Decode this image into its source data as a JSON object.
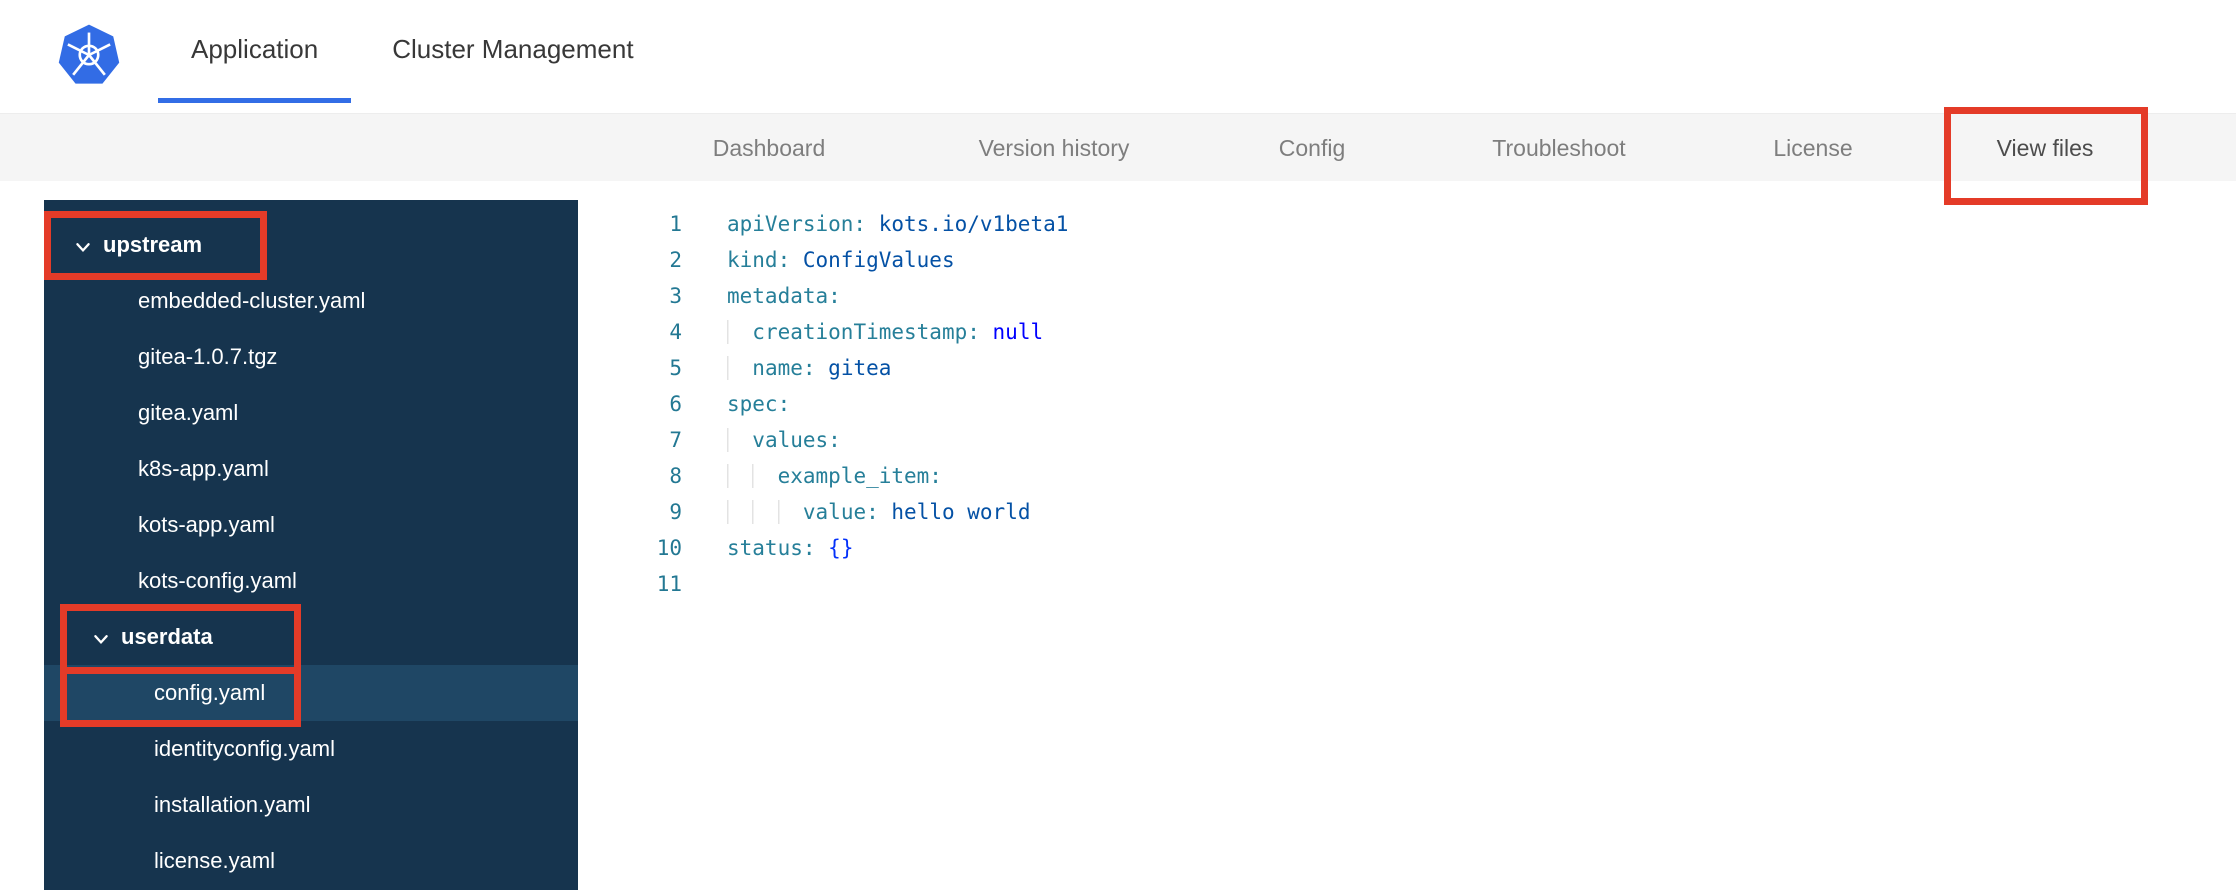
{
  "header": {
    "logo": "kubernetes-logo",
    "tabs": [
      {
        "label": "Application",
        "active": true
      },
      {
        "label": "Cluster Management",
        "active": false
      }
    ]
  },
  "subnav": {
    "tabs": [
      {
        "label": "Dashboard",
        "active": false
      },
      {
        "label": "Version history",
        "active": false
      },
      {
        "label": "Config",
        "active": false
      },
      {
        "label": "Troubleshoot",
        "active": false
      },
      {
        "label": "License",
        "active": false
      },
      {
        "label": "View files",
        "active": true,
        "annotated": true
      }
    ]
  },
  "file_tree": {
    "items": [
      {
        "type": "folder",
        "label": "upstream",
        "indent": 0,
        "expanded": true,
        "annotated": true
      },
      {
        "type": "file",
        "label": "embedded-cluster.yaml",
        "indent": 1
      },
      {
        "type": "file",
        "label": "gitea-1.0.7.tgz",
        "indent": 1
      },
      {
        "type": "file",
        "label": "gitea.yaml",
        "indent": 1
      },
      {
        "type": "file",
        "label": "k8s-app.yaml",
        "indent": 1
      },
      {
        "type": "file",
        "label": "kots-app.yaml",
        "indent": 1
      },
      {
        "type": "file",
        "label": "kots-config.yaml",
        "indent": 1
      },
      {
        "type": "folder",
        "label": "userdata",
        "indent": 1,
        "expanded": true,
        "annotated": true
      },
      {
        "type": "file",
        "label": "config.yaml",
        "indent": 2,
        "selected": true,
        "annotated": true
      },
      {
        "type": "file",
        "label": "identityconfig.yaml",
        "indent": 2
      },
      {
        "type": "file",
        "label": "installation.yaml",
        "indent": 2
      },
      {
        "type": "file",
        "label": "license.yaml",
        "indent": 2
      }
    ]
  },
  "editor": {
    "language": "yaml",
    "lines": [
      {
        "tokens": [
          {
            "c": "k",
            "t": "apiVersion:"
          },
          {
            "c": "sp",
            "t": " "
          },
          {
            "c": "v",
            "t": "kots.io/v1beta1"
          }
        ]
      },
      {
        "tokens": [
          {
            "c": "k",
            "t": "kind:"
          },
          {
            "c": "sp",
            "t": " "
          },
          {
            "c": "v",
            "t": "ConfigValues"
          }
        ]
      },
      {
        "tokens": [
          {
            "c": "k",
            "t": "metadata:"
          }
        ]
      },
      {
        "tokens": [
          {
            "c": "ind",
            "t": "  "
          },
          {
            "c": "k",
            "t": "creationTimestamp:"
          },
          {
            "c": "sp",
            "t": " "
          },
          {
            "c": "kw",
            "t": "null"
          }
        ]
      },
      {
        "tokens": [
          {
            "c": "ind",
            "t": "  "
          },
          {
            "c": "k",
            "t": "name:"
          },
          {
            "c": "sp",
            "t": " "
          },
          {
            "c": "v",
            "t": "gitea"
          }
        ]
      },
      {
        "tokens": [
          {
            "c": "k",
            "t": "spec:"
          }
        ]
      },
      {
        "tokens": [
          {
            "c": "ind",
            "t": "  "
          },
          {
            "c": "k",
            "t": "values:"
          }
        ]
      },
      {
        "tokens": [
          {
            "c": "ind",
            "t": "  "
          },
          {
            "c": "ind",
            "t": "  "
          },
          {
            "c": "k",
            "t": "example_item:"
          }
        ]
      },
      {
        "tokens": [
          {
            "c": "ind",
            "t": "  "
          },
          {
            "c": "ind",
            "t": "  "
          },
          {
            "c": "ind",
            "t": "  "
          },
          {
            "c": "k",
            "t": "value:"
          },
          {
            "c": "sp",
            "t": " "
          },
          {
            "c": "v",
            "t": "hello world"
          }
        ]
      },
      {
        "tokens": [
          {
            "c": "k",
            "t": "status:"
          },
          {
            "c": "sp",
            "t": " "
          },
          {
            "c": "br",
            "t": "{}"
          }
        ]
      },
      {
        "tokens": []
      }
    ]
  },
  "annotations": {
    "color": "#e43b28",
    "boxes": [
      "view-files-tab",
      "upstream-folder",
      "userdata-folder",
      "config-yaml-file"
    ]
  },
  "colors": {
    "accent_blue": "#326de6",
    "annotation_red": "#e43b28",
    "sidebar_bg": "#16344e",
    "sidebar_selected_bg": "#1f4765",
    "subnav_bg": "#f5f5f5",
    "subnav_text": "#7e7e7e",
    "subnav_text_active": "#4c4c4c",
    "code_key": "#267f99",
    "code_value": "#0451a5",
    "code_keyword": "#0000ff",
    "line_number": "#237893"
  }
}
